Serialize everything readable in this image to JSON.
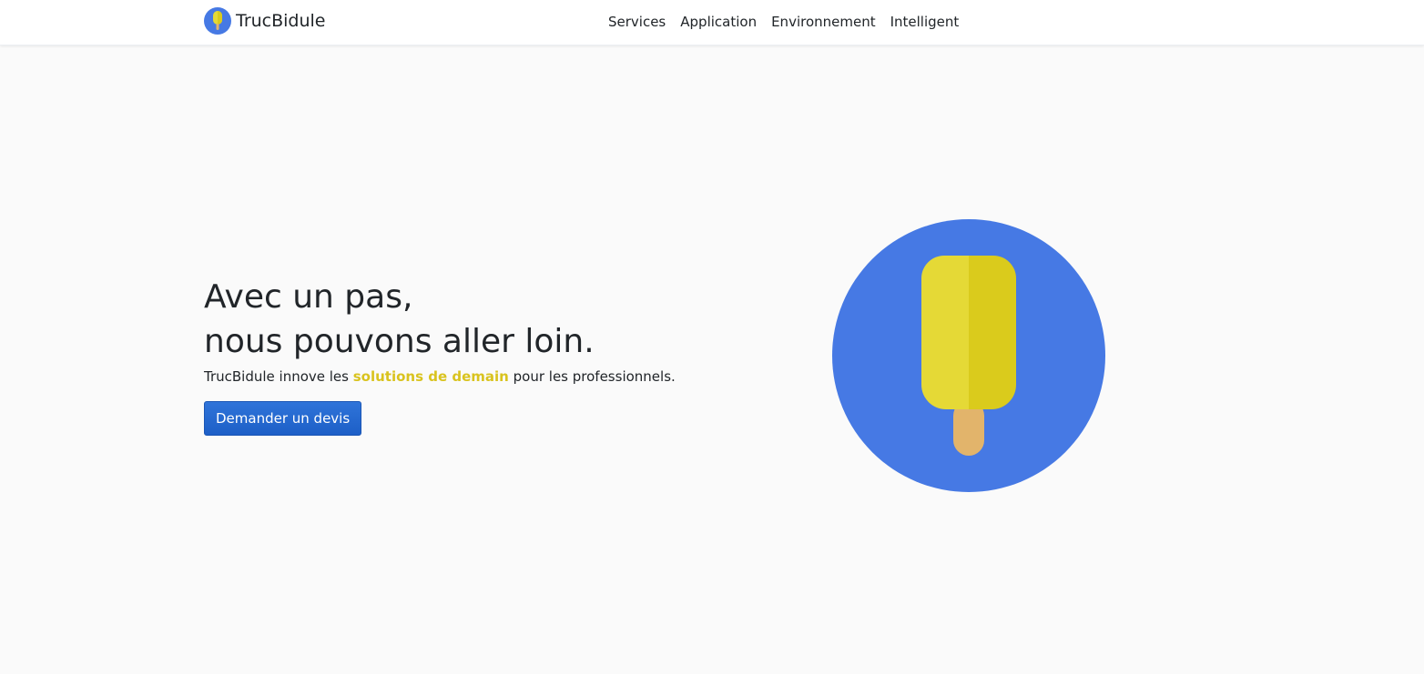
{
  "nav": {
    "brand": "TrucBidule",
    "links": [
      "Services",
      "Application",
      "Environnement",
      "Intelligent"
    ]
  },
  "hero": {
    "headline_line1": "Avec un pas,",
    "headline_line2": "nous pouvons aller loin.",
    "tagline_prefix": "TrucBidule innove les ",
    "tagline_highlight": "solutions de demain",
    "tagline_suffix": " pour les professionnels.",
    "cta_label": "Demander un devis"
  },
  "icons": {
    "logo": "popsicle-logo-icon",
    "illustration": "popsicle-illustration"
  },
  "colors": {
    "brand_blue": "#4679e4",
    "popsicle_yellow_light": "#e5d936",
    "popsicle_yellow_dark": "#dacb1c",
    "stick": "#e2b46b",
    "highlight_text": "#d9c31e",
    "button_blue": "#2767d0"
  }
}
